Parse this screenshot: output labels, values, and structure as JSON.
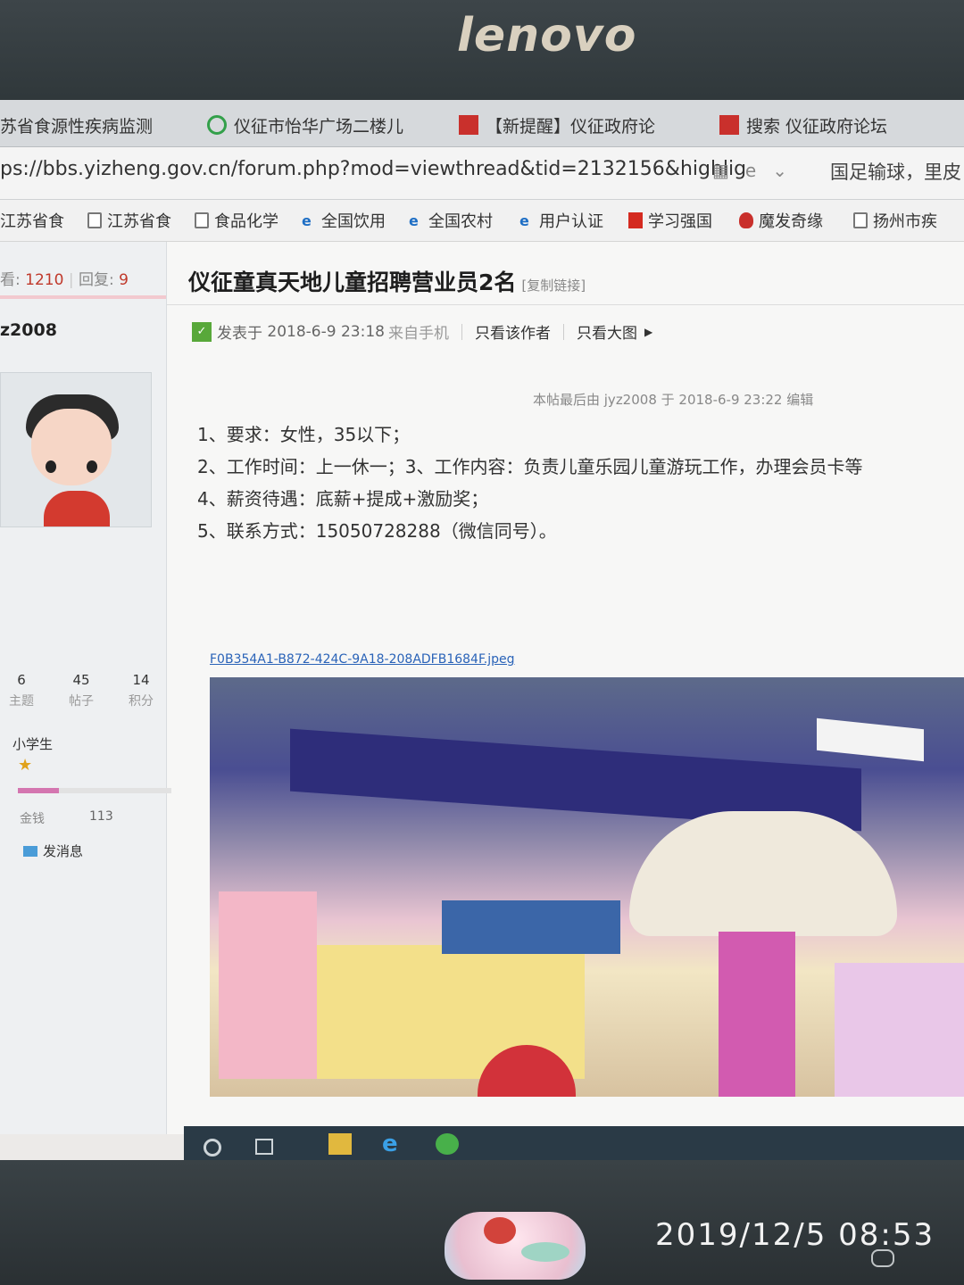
{
  "monitor": {
    "brand": "lenovo",
    "photo_timestamp": "2019/12/5  08:53"
  },
  "browser": {
    "tabs": [
      {
        "label": "苏省食源性疾病监测",
        "icon": "page-icon"
      },
      {
        "label": "仪征市怡华广场二楼儿",
        "icon": "qihoo-search-icon"
      },
      {
        "label": "【新提醒】仪征政府论",
        "icon": "forum-logo-icon"
      },
      {
        "label": "搜索 仪征政府论坛",
        "icon": "forum-logo-icon"
      }
    ],
    "url": "ps://bbs.yizheng.gov.cn/forum.php?mod=viewthread&tid=2132156&highlig",
    "url_domain": "bbs.yizheng.gov.cn",
    "search_text": "国足输球，里皮",
    "bookmarks": [
      {
        "label": "江苏省食",
        "icon": "page-icon"
      },
      {
        "label": "江苏省食",
        "icon": "page-icon"
      },
      {
        "label": "食品化学",
        "icon": "page-icon"
      },
      {
        "label": "全国饮用",
        "icon": "ie-icon"
      },
      {
        "label": "全国农村",
        "icon": "ie-icon"
      },
      {
        "label": "用户认证",
        "icon": "ie-icon"
      },
      {
        "label": "学习强国",
        "icon": "xuexi-icon"
      },
      {
        "label": "魔发奇缘",
        "icon": "flame-icon"
      },
      {
        "label": "扬州市疾",
        "icon": "page-icon"
      }
    ]
  },
  "thread": {
    "views_label": "看:",
    "views": "1210",
    "replies_label": "回复:",
    "replies": "9",
    "author": "z2008",
    "title": "仪征童真天地儿童招聘营业员2名",
    "title_tag": "[复制链接]",
    "posted_prefix": "发表于",
    "posted_time": "2018-6-9 23:18",
    "posted_source": "来自手机",
    "only_author": "只看该作者",
    "only_large_images": "只看大图",
    "edit_note": "本帖最后由 jyz2008 于 2018-6-9 23:22 编辑",
    "body_lines": [
      "1、要求：女性，35以下；",
      "2、工作时间：上一休一；3、工作内容：负责儿童乐园儿童游玩工作，办理会员卡等",
      "4、薪资待遇：底薪+提成+激励奖；",
      "5、联系方式：15050728288（微信同号）。"
    ],
    "attachment_name": "F0B354A1-B872-424C-9A18-208ADFB1684F.jpeg"
  },
  "author_profile": {
    "stats": [
      {
        "value": "6",
        "label": "主题"
      },
      {
        "value": "45",
        "label": "帖子"
      },
      {
        "value": "14",
        "label": "积分"
      }
    ],
    "rank": "小学生",
    "level_progress": 0.27,
    "gold_label": "金钱",
    "gold_value": "113",
    "send_message": "发消息"
  },
  "colors": {
    "accent_red": "#c0392b",
    "link_blue": "#2a63b8",
    "progress_pink": "#d476b0"
  }
}
